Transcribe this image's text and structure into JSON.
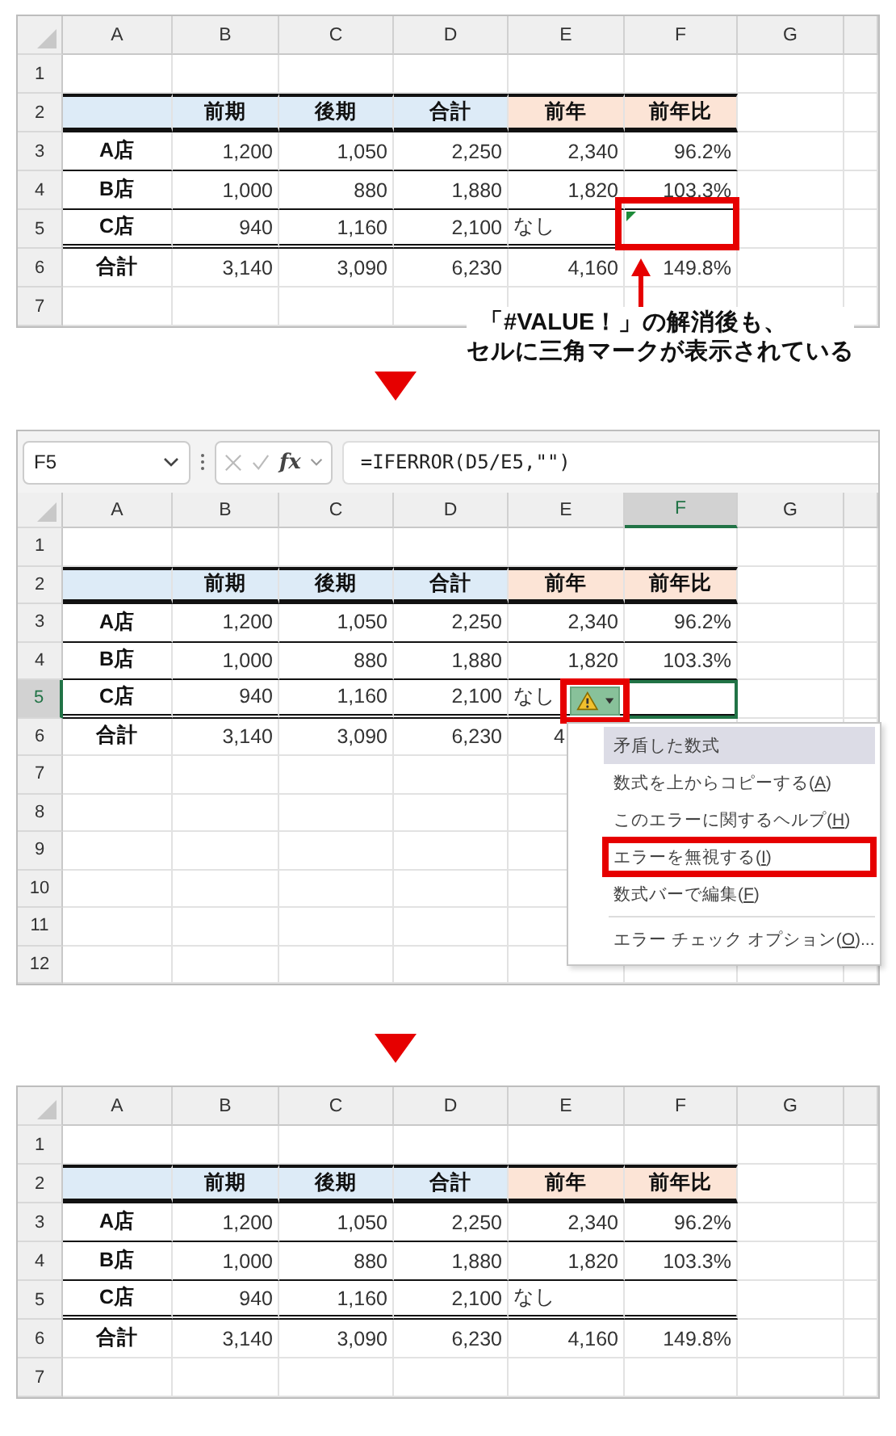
{
  "panels": [
    {
      "columns": [
        {
          "label": "A",
          "selected": false
        },
        {
          "label": "B",
          "selected": false
        },
        {
          "label": "C",
          "selected": false
        },
        {
          "label": "D",
          "selected": false
        },
        {
          "label": "E",
          "selected": false
        },
        {
          "label": "F",
          "selected": false
        },
        {
          "label": "G",
          "selected": false
        }
      ],
      "rows": [
        {
          "label": "1",
          "selected": false
        },
        {
          "label": "2",
          "selected": false,
          "cells": [
            {
              "color": "#ddebf7"
            },
            {
              "text": "前期",
              "color": "#ddebf7"
            },
            {
              "text": "後期",
              "color": "#ddebf7"
            },
            {
              "text": "合計",
              "color": "#ddebf7"
            },
            {
              "text": "前年",
              "color": "#fce4d6"
            },
            {
              "text": "前年比",
              "color": "#fce4d6"
            }
          ]
        },
        {
          "label": "3",
          "selected": false,
          "cells": [
            {
              "text": "A店"
            },
            {
              "text": "1,200"
            },
            {
              "text": "1,050"
            },
            {
              "text": "2,250"
            },
            {
              "text": "2,340"
            },
            {
              "text": "96.2%"
            }
          ]
        },
        {
          "label": "4",
          "selected": false,
          "cells": [
            {
              "text": "B店"
            },
            {
              "text": "1,000"
            },
            {
              "text": "880"
            },
            {
              "text": "1,880"
            },
            {
              "text": "1,820"
            },
            {
              "text": "103.3%"
            }
          ]
        },
        {
          "label": "5",
          "selected": false,
          "cells": [
            {
              "text": "C店"
            },
            {
              "text": "940"
            },
            {
              "text": "1,160"
            },
            {
              "text": "2,100"
            },
            {
              "text": "なし",
              "kind": "text"
            },
            {
              "error_triangle": true,
              "annotated": true
            }
          ]
        },
        {
          "label": "6",
          "selected": false,
          "cells": [
            {
              "text": "合計"
            },
            {
              "text": "3,140"
            },
            {
              "text": "3,090"
            },
            {
              "text": "6,230"
            },
            {
              "text": "4,160"
            },
            {
              "text": "149.8%"
            }
          ]
        },
        {
          "label": "7",
          "selected": false
        }
      ],
      "callout": {
        "lines": [
          "「#VALUE！」の解消後も、",
          "セルに三角マークが表示されている"
        ]
      }
    },
    {
      "formula_bar": {
        "name_box": "F5",
        "function_button": "fx",
        "formula": "=IFERROR(D5/E5,\"\")"
      },
      "columns": [
        {
          "label": "A",
          "selected": false
        },
        {
          "label": "B",
          "selected": false
        },
        {
          "label": "C",
          "selected": false
        },
        {
          "label": "D",
          "selected": false
        },
        {
          "label": "E",
          "selected": false
        },
        {
          "label": "F",
          "selected": true
        },
        {
          "label": "G",
          "selected": false
        }
      ],
      "rows": [
        {
          "label": "1",
          "selected": false
        },
        {
          "label": "2",
          "selected": false,
          "cells": [
            {
              "color": "#ddebf7"
            },
            {
              "text": "前期",
              "color": "#ddebf7"
            },
            {
              "text": "後期",
              "color": "#ddebf7"
            },
            {
              "text": "合計",
              "color": "#ddebf7"
            },
            {
              "text": "前年",
              "color": "#fce4d6"
            },
            {
              "text": "前年比",
              "color": "#fce4d6"
            }
          ]
        },
        {
          "label": "3",
          "selected": false,
          "cells": [
            {
              "text": "A店"
            },
            {
              "text": "1,200"
            },
            {
              "text": "1,050"
            },
            {
              "text": "2,250"
            },
            {
              "text": "2,340"
            },
            {
              "text": "96.2%"
            }
          ]
        },
        {
          "label": "4",
          "selected": false,
          "cells": [
            {
              "text": "B店"
            },
            {
              "text": "1,000"
            },
            {
              "text": "880"
            },
            {
              "text": "1,880"
            },
            {
              "text": "1,820"
            },
            {
              "text": "103.3%"
            }
          ]
        },
        {
          "label": "5",
          "selected": true,
          "cells": [
            {
              "text": "C店"
            },
            {
              "text": "940"
            },
            {
              "text": "1,160"
            },
            {
              "text": "2,100"
            },
            {
              "text": "なし",
              "kind": "text",
              "error_button": {
                "annotated": true
              }
            },
            {}
          ]
        },
        {
          "label": "6",
          "selected": false,
          "cells": [
            {
              "text": "合計"
            },
            {
              "text": "3,140"
            },
            {
              "text": "3,090"
            },
            {
              "text": "6,230"
            },
            {
              "text": "4",
              "kind": "partial"
            }
          ]
        },
        {
          "label": "7",
          "selected": false
        },
        {
          "label": "8",
          "selected": false
        },
        {
          "label": "9",
          "selected": false
        },
        {
          "label": "10",
          "selected": false
        },
        {
          "label": "11",
          "selected": false
        },
        {
          "label": "12",
          "selected": false
        }
      ],
      "menu": [
        {
          "kind": "header",
          "text": "矛盾した数式"
        },
        {
          "kind": "item",
          "text": "数式を上からコピーする(",
          "key": "A",
          "tail": ")",
          "annotated": false
        },
        {
          "kind": "item",
          "text": "このエラーに関するヘルプ(",
          "key": "H",
          "tail": ")",
          "annotated": false
        },
        {
          "kind": "item",
          "text": "エラーを無視する(",
          "key": "I",
          "tail": ")",
          "annotated": true
        },
        {
          "kind": "item",
          "text": "数式バーで編集(",
          "key": "F",
          "tail": ")",
          "annotated": false
        },
        {
          "kind": "separator"
        },
        {
          "kind": "item",
          "text": "エラー チェック オプション(",
          "key": "O",
          "tail": ")...",
          "annotated": false
        }
      ]
    },
    {
      "columns": [
        {
          "label": "A",
          "selected": false
        },
        {
          "label": "B",
          "selected": false
        },
        {
          "label": "C",
          "selected": false
        },
        {
          "label": "D",
          "selected": false
        },
        {
          "label": "E",
          "selected": false
        },
        {
          "label": "F",
          "selected": false
        },
        {
          "label": "G",
          "selected": false
        }
      ],
      "rows": [
        {
          "label": "1",
          "selected": false
        },
        {
          "label": "2",
          "selected": false,
          "cells": [
            {
              "color": "#ddebf7"
            },
            {
              "text": "前期",
              "color": "#ddebf7"
            },
            {
              "text": "後期",
              "color": "#ddebf7"
            },
            {
              "text": "合計",
              "color": "#ddebf7"
            },
            {
              "text": "前年",
              "color": "#fce4d6"
            },
            {
              "text": "前年比",
              "color": "#fce4d6"
            }
          ]
        },
        {
          "label": "3",
          "selected": false,
          "cells": [
            {
              "text": "A店"
            },
            {
              "text": "1,200"
            },
            {
              "text": "1,050"
            },
            {
              "text": "2,250"
            },
            {
              "text": "2,340"
            },
            {
              "text": "96.2%"
            }
          ]
        },
        {
          "label": "4",
          "selected": false,
          "cells": [
            {
              "text": "B店"
            },
            {
              "text": "1,000"
            },
            {
              "text": "880"
            },
            {
              "text": "1,880"
            },
            {
              "text": "1,820"
            },
            {
              "text": "103.3%"
            }
          ]
        },
        {
          "label": "5",
          "selected": false,
          "cells": [
            {
              "text": "C店"
            },
            {
              "text": "940"
            },
            {
              "text": "1,160"
            },
            {
              "text": "2,100"
            },
            {
              "text": "なし",
              "kind": "text"
            },
            {}
          ]
        },
        {
          "label": "6",
          "selected": false,
          "cells": [
            {
              "text": "合計"
            },
            {
              "text": "3,140"
            },
            {
              "text": "3,090"
            },
            {
              "text": "6,230"
            },
            {
              "text": "4,160"
            },
            {
              "text": "149.8%"
            }
          ]
        },
        {
          "label": "7",
          "selected": false
        }
      ]
    }
  ]
}
